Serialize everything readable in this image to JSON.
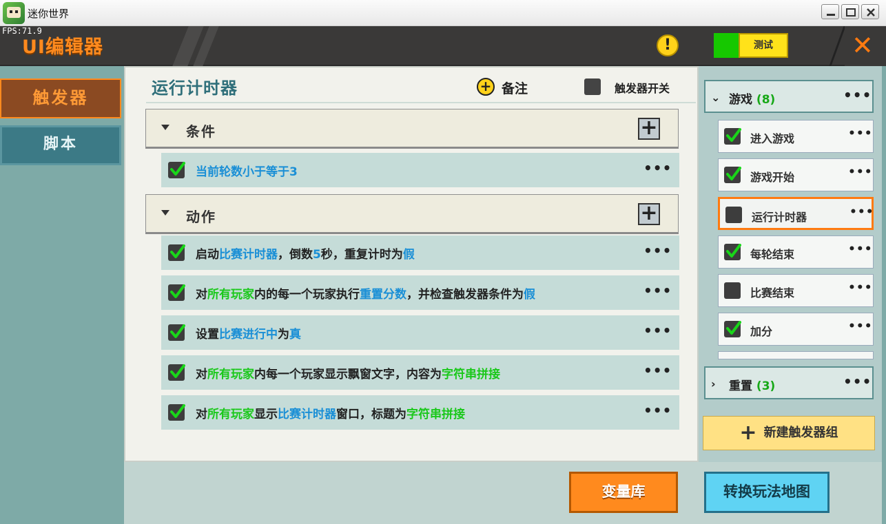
{
  "window": {
    "title": "迷你世界",
    "controls": [
      "minimize-icon",
      "maximize-icon",
      "close-icon"
    ]
  },
  "header": {
    "fps": "FPS:71.9",
    "title": "UI编辑器",
    "warning_glyph": "!",
    "test_label": "测试",
    "close_glyph": "✕"
  },
  "nav": {
    "trigger": "触发器",
    "script": "脚本"
  },
  "main": {
    "title": "运行计时器",
    "note_label": "备注",
    "switch_label": "触发器开关",
    "condition_section": "条件",
    "action_section": "动作",
    "conditions": [
      {
        "segments": [
          {
            "t": "当前轮数小于等于3",
            "c": "blue"
          }
        ],
        "checked": true
      }
    ],
    "actions": [
      {
        "checked": true,
        "segments": [
          {
            "t": "启动",
            "c": "black"
          },
          {
            "t": "比赛计时器",
            "c": "blue"
          },
          {
            "t": "，倒数",
            "c": "black"
          },
          {
            "t": "5",
            "c": "blue"
          },
          {
            "t": "秒，重复计时为",
            "c": "black"
          },
          {
            "t": "假",
            "c": "blue"
          }
        ]
      },
      {
        "checked": true,
        "segments": [
          {
            "t": "对",
            "c": "black"
          },
          {
            "t": "所有玩家",
            "c": "green"
          },
          {
            "t": "内的每一个玩家执行",
            "c": "black"
          },
          {
            "t": "重置分数",
            "c": "blue"
          },
          {
            "t": "，并检查触发器条件为",
            "c": "black"
          },
          {
            "t": "假",
            "c": "blue"
          }
        ]
      },
      {
        "checked": true,
        "segments": [
          {
            "t": "设置",
            "c": "black"
          },
          {
            "t": "比赛进行中",
            "c": "blue"
          },
          {
            "t": "为",
            "c": "black"
          },
          {
            "t": "真",
            "c": "blue"
          }
        ]
      },
      {
        "checked": true,
        "segments": [
          {
            "t": "对",
            "c": "black"
          },
          {
            "t": "所有玩家",
            "c": "green"
          },
          {
            "t": "内每一个玩家显示飘窗文字，内容为",
            "c": "black"
          },
          {
            "t": "字符串拼接",
            "c": "green"
          }
        ]
      },
      {
        "checked": true,
        "segments": [
          {
            "t": "对",
            "c": "black"
          },
          {
            "t": "所有玩家",
            "c": "green"
          },
          {
            "t": "显示",
            "c": "black"
          },
          {
            "t": "比赛计时器",
            "c": "blue"
          },
          {
            "t": "窗口，标题为",
            "c": "black"
          },
          {
            "t": "字符串拼接",
            "c": "green"
          }
        ]
      }
    ]
  },
  "right": {
    "group1": {
      "name": "游戏",
      "count": "(8)",
      "chevron": "⌄"
    },
    "items": [
      {
        "name": "进入游戏",
        "checked": true,
        "selected": false
      },
      {
        "name": "游戏开始",
        "checked": true,
        "selected": false
      },
      {
        "name": "运行计时器",
        "checked": false,
        "selected": true
      },
      {
        "name": "每轮结束",
        "checked": true,
        "selected": false
      },
      {
        "name": "比赛结束",
        "checked": false,
        "selected": false
      },
      {
        "name": "加分",
        "checked": true,
        "selected": false
      }
    ],
    "group2": {
      "name": "重置",
      "count": "(3)",
      "chevron": "›"
    },
    "new_group": "新建触发器组",
    "dots": "•••"
  },
  "bottom": {
    "variables": "变量库",
    "convert_map": "转换玩法地图"
  },
  "colors": {
    "accent_orange": "#ff8a1e",
    "teal": "#7eaaa7",
    "blue_text": "#1a8fd6",
    "green_text": "#1ac81a"
  }
}
